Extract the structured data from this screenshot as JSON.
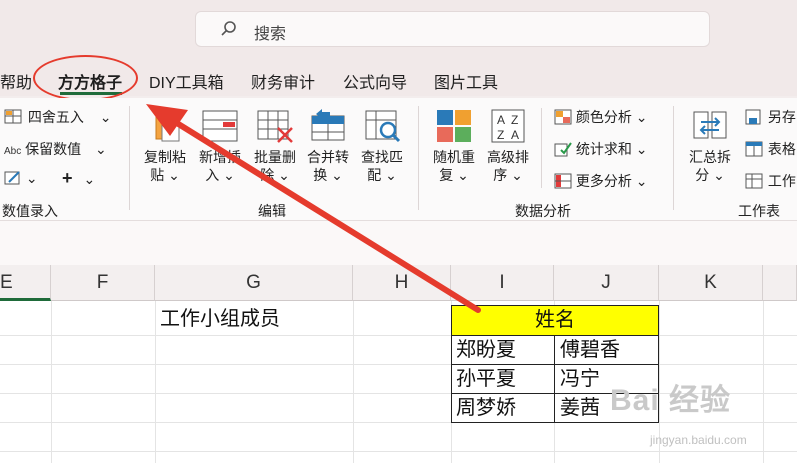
{
  "search": {
    "placeholder": "搜索",
    "icon": "search-icon"
  },
  "tabs": [
    "帮助",
    "方方格子",
    "DIY工具箱",
    "财务审计",
    "公式向导",
    "图片工具"
  ],
  "active_tab": "方方格子",
  "ribbon": {
    "data_entry": {
      "round_label": "四舍五入",
      "keep_value_label": "保留数值",
      "plus_label": "+",
      "group_label": "数值录入"
    },
    "edit": {
      "copy_paste_label": [
        "复制粘",
        "贴"
      ],
      "add_insert_label": [
        "新增插",
        "入"
      ],
      "batch_delete_label": [
        "批量删",
        "除"
      ],
      "merge_convert_label": [
        "合并转",
        "换"
      ],
      "find_match_label": [
        "查找匹",
        "配"
      ],
      "group_label": "编辑"
    },
    "data_analysis": {
      "random_repeat_label": [
        "随机重",
        "复"
      ],
      "advanced_sort_label": [
        "高级排",
        "序"
      ],
      "color_analysis_label": "颜色分析",
      "stat_sum_label": "统计求和",
      "more_analysis_label": "更多分析",
      "group_label": "数据分析"
    },
    "worksheet": {
      "summary_split_label": [
        "汇总拆",
        "分"
      ],
      "save_as_label": "另存",
      "table_label": "表格",
      "work_label": "工作",
      "group_label": "工作表"
    }
  },
  "sheet": {
    "columns": [
      "E",
      "F",
      "G",
      "H",
      "I",
      "J",
      "K"
    ],
    "g1": "工作小组成员",
    "header": "姓名",
    "names": [
      [
        "郑盼夏",
        "傅碧香"
      ],
      [
        "孙平夏",
        "冯宁"
      ],
      [
        "周梦娇",
        "姜茜"
      ]
    ]
  },
  "watermark": {
    "brand": "Bai 经验",
    "url": "jingyan.baidu.com"
  },
  "colors": {
    "accent_green": "#1f6b3a",
    "annotation_red": "#e53b2d",
    "header_yellow": "#ffff00"
  }
}
